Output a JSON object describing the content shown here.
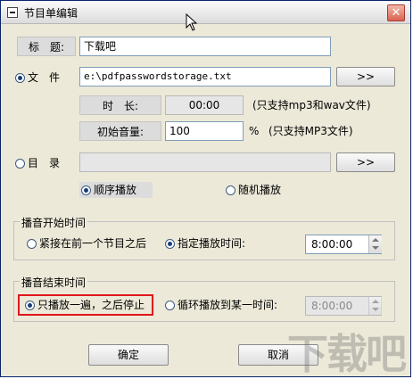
{
  "window": {
    "title": "节目单编辑",
    "close_glyph": "✕"
  },
  "title_row": {
    "label": "标　题:",
    "value": "下载吧"
  },
  "file_row": {
    "radio_label": "文　件",
    "selected": true,
    "path": "e:\\pdfpasswordstorage.txt",
    "browse_label": ">>"
  },
  "duration_row": {
    "label": "时　长:",
    "value": "00:00",
    "note": "(只支持mp3和wav文件)"
  },
  "volume_row": {
    "label": "初始音量:",
    "value": "100",
    "unit": "%",
    "note": "(只支持MP3文件)"
  },
  "dir_row": {
    "radio_label": "目　录",
    "selected": false,
    "value": "",
    "browse_label": ">>"
  },
  "play_order": {
    "options": [
      {
        "label": "顺序播放",
        "selected": true
      },
      {
        "label": "随机播放",
        "selected": false
      }
    ]
  },
  "start_group": {
    "legend": "播音开始时间",
    "options": [
      {
        "label": "紧接在前一个节目之后",
        "selected": false
      },
      {
        "label": "指定播放时间:",
        "selected": true
      }
    ],
    "time": "8:00:00"
  },
  "end_group": {
    "legend": "播音结束时间",
    "options": [
      {
        "label": "只播放一遍，之后停止",
        "selected": true
      },
      {
        "label": "循环播放到某一时间:",
        "selected": false
      }
    ],
    "time": "8:00:00"
  },
  "buttons": {
    "ok": "确定",
    "cancel": "取消"
  },
  "watermark": "下载吧",
  "colors": {
    "highlight": "#e0151b",
    "titlebar_close": "#d9634f"
  },
  "icons": [
    "system-menu-icon",
    "close-icon",
    "mouse-cursor-icon"
  ]
}
